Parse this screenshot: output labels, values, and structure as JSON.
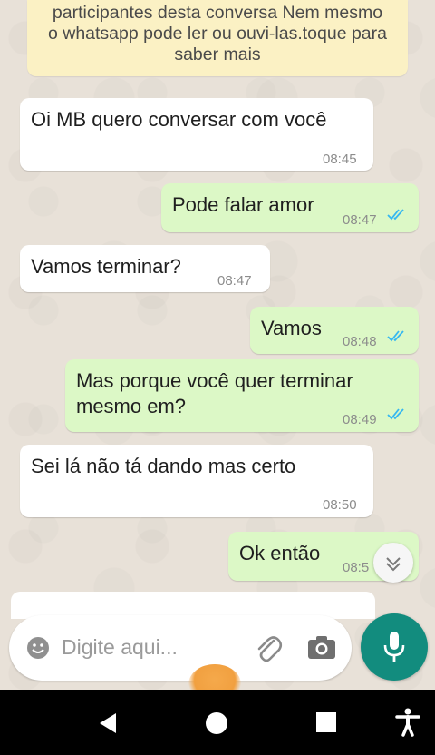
{
  "notice": {
    "line1": "participantes desta conversa Nem mesmo",
    "line2": "o whatsapp pode ler ou ouvi-las.toque para",
    "line3": "saber mais"
  },
  "messages": [
    {
      "direction": "in",
      "text": "Oi MB quero conversar com você",
      "time": "08:45"
    },
    {
      "direction": "out",
      "text": "Pode falar amor",
      "time": "08:47",
      "status": "read"
    },
    {
      "direction": "in",
      "text": "Vamos terminar?",
      "time": "08:47"
    },
    {
      "direction": "out",
      "text": "Vamos",
      "time": "08:48",
      "status": "read"
    },
    {
      "direction": "out",
      "text_line1": "Mas porque você quer terminar",
      "text_line2": "mesmo em?",
      "time": "08:49",
      "status": "read"
    },
    {
      "direction": "in",
      "text": "Sei lá não tá dando mas certo",
      "time": "08:50"
    },
    {
      "direction": "out",
      "text": "Ok então",
      "time": "08:5",
      "status": "read"
    }
  ],
  "composer": {
    "placeholder": "Digite aqui...",
    "icons": [
      "emoji-icon",
      "attach-icon",
      "camera-icon",
      "mic-icon"
    ]
  },
  "colors": {
    "incoming_bubble": "#ffffff",
    "outgoing_bubble": "#dcf8c6",
    "read_ticks": "#34b7f1",
    "mic_button": "#128c7e",
    "notice_bg": "#fbf1c4"
  },
  "nav_icons": [
    "back-icon",
    "home-icon",
    "recents-icon",
    "accessibility-icon"
  ]
}
